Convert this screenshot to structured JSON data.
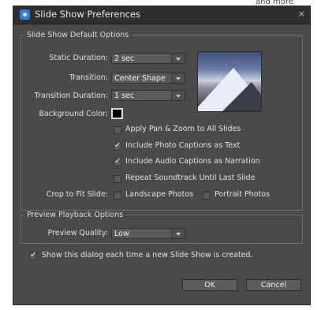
{
  "corner_text": "and more",
  "dialog": {
    "title": "Slide Show Preferences",
    "close": "×"
  },
  "defaults": {
    "legend": "Slide Show Default Options",
    "static_duration": {
      "label": "Static Duration:",
      "value": "2 sec"
    },
    "transition": {
      "label": "Transition:",
      "value": "Center Shape"
    },
    "transition_duration": {
      "label": "Transition Duration:",
      "value": "1 sec"
    },
    "background_color": {
      "label": "Background Color:",
      "color": "#000000"
    },
    "checkboxes": [
      {
        "label": "Apply Pan & Zoom to All Slides",
        "checked": false
      },
      {
        "label": "Include Photo Captions as Text",
        "checked": true
      },
      {
        "label": "Include Audio Captions as Narration",
        "checked": true
      },
      {
        "label": "Repeat Soundtrack Until Last Slide",
        "checked": false
      }
    ],
    "crop": {
      "label": "Crop to Fit Slide:",
      "landscape": {
        "label": "Landscape Photos",
        "checked": false
      },
      "portrait": {
        "label": "Portrait Photos",
        "checked": false
      }
    }
  },
  "preview": {
    "legend": "Preview Playback Options",
    "quality": {
      "label": "Preview Quality:",
      "value": "Low"
    }
  },
  "show_dialog": {
    "label": "Show this dialog each time a new Slide Show is created.",
    "checked": true
  },
  "buttons": {
    "ok": "OK",
    "cancel": "Cancel"
  }
}
